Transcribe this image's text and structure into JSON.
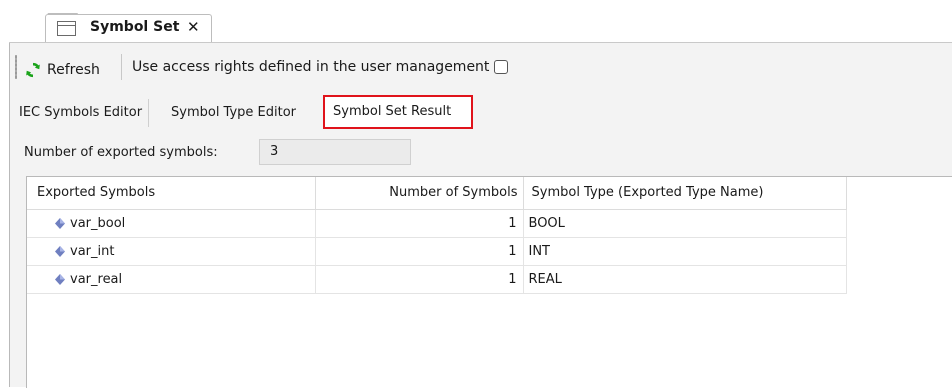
{
  "document_tab": {
    "title": "Symbol Set",
    "close_glyph": "✕",
    "icon": "window-icon"
  },
  "toolbar": {
    "refresh_label": "Refresh",
    "refresh_icon": "refresh-icon",
    "refresh_icon_color": "#1aa31a",
    "access_rights_label": "Use access rights defined in the user management",
    "access_rights_checked": false
  },
  "subtabs": [
    {
      "label": "IEC Symbols Editor",
      "active": false
    },
    {
      "label": "Symbol Type Editor",
      "active": false
    },
    {
      "label": "Symbol Set Result",
      "active": true
    }
  ],
  "highlight_color": "#e0131b",
  "summary": {
    "count_label": "Number of exported symbols:",
    "count_value": "3"
  },
  "table": {
    "columns": [
      "Exported Symbols",
      "Number of Symbols",
      "Symbol Type (Exported Type Name)"
    ],
    "rows": [
      {
        "name": "var_bool",
        "count": "1",
        "type": "BOOL",
        "icon": "variable-icon"
      },
      {
        "name": "var_int",
        "count": "1",
        "type": "INT",
        "icon": "variable-icon"
      },
      {
        "name": "var_real",
        "count": "1",
        "type": "REAL",
        "icon": "variable-icon"
      }
    ]
  }
}
